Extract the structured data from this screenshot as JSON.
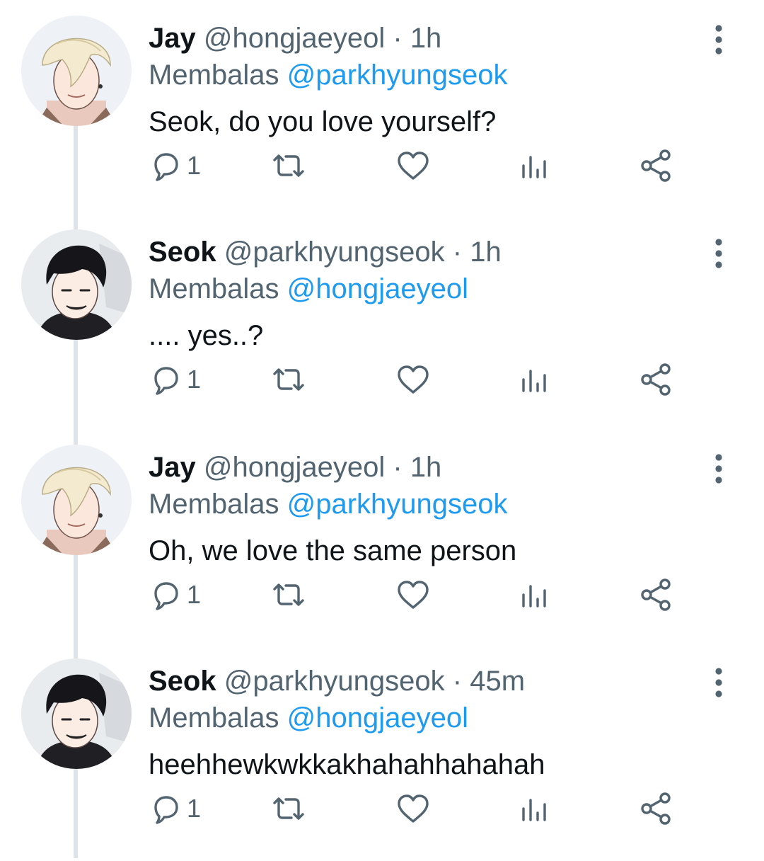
{
  "tweets": [
    {
      "display_name": "Jay",
      "handle": "@hongjaeyeol",
      "time": "1h",
      "reply_prefix": "Membalas",
      "reply_to": "@parkhyungseok",
      "text": "Seok, do you love yourself?",
      "reply_count": "1",
      "avatar": "blonde-hair-avatar"
    },
    {
      "display_name": "Seok",
      "handle": "@parkhyungseok",
      "time": "1h",
      "reply_prefix": "Membalas",
      "reply_to": "@hongjaeyeol",
      "text": ".... yes..?",
      "reply_count": "1",
      "avatar": "black-hair-avatar"
    },
    {
      "display_name": "Jay",
      "handle": "@hongjaeyeol",
      "time": "1h",
      "reply_prefix": "Membalas",
      "reply_to": "@parkhyungseok",
      "text": "Oh, we love the same person",
      "reply_count": "1",
      "avatar": "blonde-hair-avatar"
    },
    {
      "display_name": "Seok",
      "handle": "@parkhyungseok",
      "time": "45m",
      "reply_prefix": "Membalas",
      "reply_to": "@hongjaeyeol",
      "text": "heehhewkwkkakhahahhahahah",
      "reply_count": "1",
      "avatar": "black-hair-avatar"
    }
  ],
  "icons": {
    "reply": "comment-bubble-icon",
    "retweet": "retweet-icon",
    "like": "heart-icon",
    "views": "bar-chart-icon",
    "share": "share-icon",
    "more": "vertical-dots-icon"
  },
  "colors": {
    "primary_text": "#0f1419",
    "secondary_text": "#536471",
    "mention": "#1d9bf0",
    "thread_line": "#dde3e8"
  },
  "separator": "·"
}
